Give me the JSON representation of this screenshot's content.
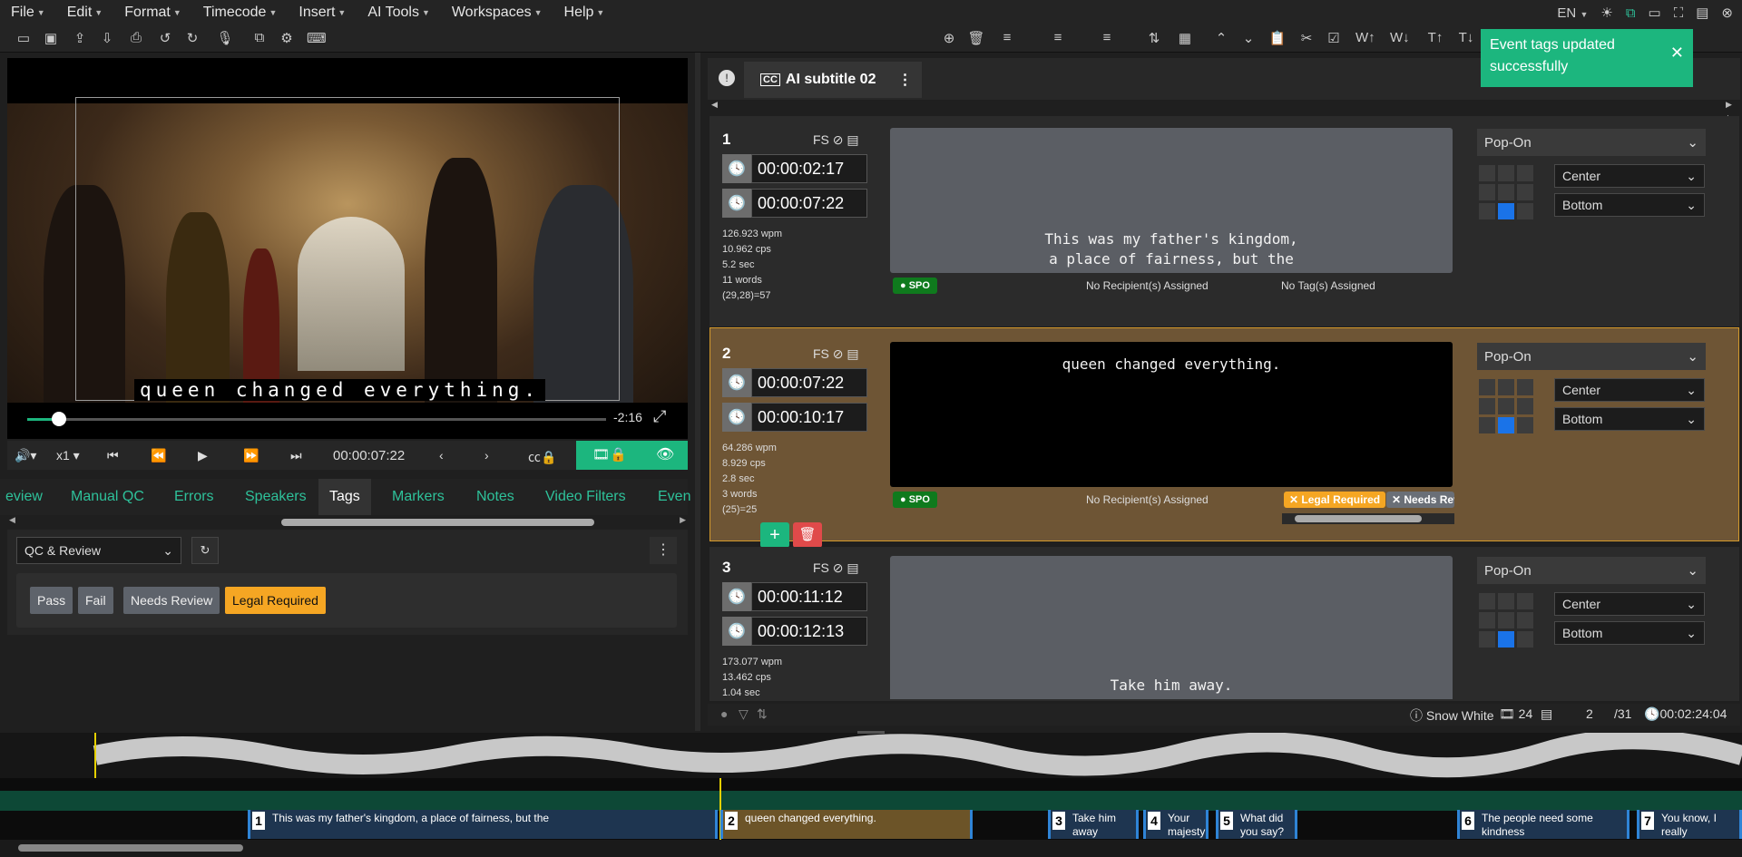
{
  "menu": [
    "File",
    "Edit",
    "Format",
    "Timecode",
    "Insert",
    "AI Tools",
    "Workspaces",
    "Help"
  ],
  "language": "EN",
  "toast": {
    "message": "Event tags updated successfully",
    "color": "#1cb67e"
  },
  "player": {
    "subtitle_overlay": "queen changed everything.",
    "remaining": "-2:16",
    "speed": "x1",
    "timecode": "00:00:07:22",
    "progress_fraction": 0.05
  },
  "left_tabs": [
    "eview",
    "Manual QC",
    "Errors",
    "Speakers",
    "Tags",
    "Markers",
    "Notes",
    "Video Filters",
    "Even"
  ],
  "active_left_tab": "Tags",
  "tags_panel": {
    "preset": "QC & Review",
    "tags": [
      {
        "label": "Pass",
        "color": "#5e636b"
      },
      {
        "label": "Fail",
        "color": "#5e636b"
      },
      {
        "label": "Needs Review",
        "color": "#5e636b"
      },
      {
        "label": "Legal Required",
        "color": "#f5a623"
      }
    ]
  },
  "track_tab": "AI subtitle 02",
  "subtitles": [
    {
      "num": "1",
      "fs": "FS",
      "start": "00:00:02:17",
      "end": "00:00:07:22",
      "wpm": "126.923 wpm",
      "cps": "10.962 cps",
      "dur": "5.2 sec",
      "words": "11 words",
      "chars": "(29,28)=57",
      "line1": "This was my father's kingdom,",
      "line2": "a place of fairness, but the",
      "speaker": "SPO",
      "recipients": "No Recipient(s) Assigned",
      "tags_text": "No Tag(s) Assigned",
      "style": "Pop-On",
      "halign": "Center",
      "valign": "Bottom"
    },
    {
      "num": "2",
      "fs": "FS",
      "start": "00:00:07:22",
      "end": "00:00:10:17",
      "wpm": "64.286 wpm",
      "cps": "8.929 cps",
      "dur": "2.8 sec",
      "words": "3 words",
      "chars": "(25)=25",
      "line1": "queen changed everything.",
      "speaker": "SPO",
      "recipients": "No Recipient(s) Assigned",
      "tag_pills": [
        "Legal Required",
        "Needs Rev"
      ],
      "style": "Pop-On",
      "halign": "Center",
      "valign": "Bottom"
    },
    {
      "num": "3",
      "fs": "FS",
      "start": "00:00:11:12",
      "end": "00:00:12:13",
      "wpm": "173.077 wpm",
      "cps": "13.462 cps",
      "dur": "1.04 sec",
      "line1": "Take him away.",
      "style": "Pop-On",
      "halign": "Center",
      "valign": "Bottom"
    }
  ],
  "status": {
    "title": "Snow White",
    "fps": "24",
    "current": "2",
    "total": "/31",
    "duration": "00:02:24:04"
  },
  "timeline": [
    {
      "num": "1",
      "text": "This was my father's kingdom, a place of fairness, but the"
    },
    {
      "num": "2",
      "text": "queen changed everything."
    },
    {
      "num": "3",
      "text": "Take him away"
    },
    {
      "num": "4",
      "text": "Your majesty"
    },
    {
      "num": "5",
      "text": "What did you say?"
    },
    {
      "num": "6",
      "text": "The people need some kindness"
    },
    {
      "num": "7",
      "text": "You know, I really remember you being"
    }
  ]
}
